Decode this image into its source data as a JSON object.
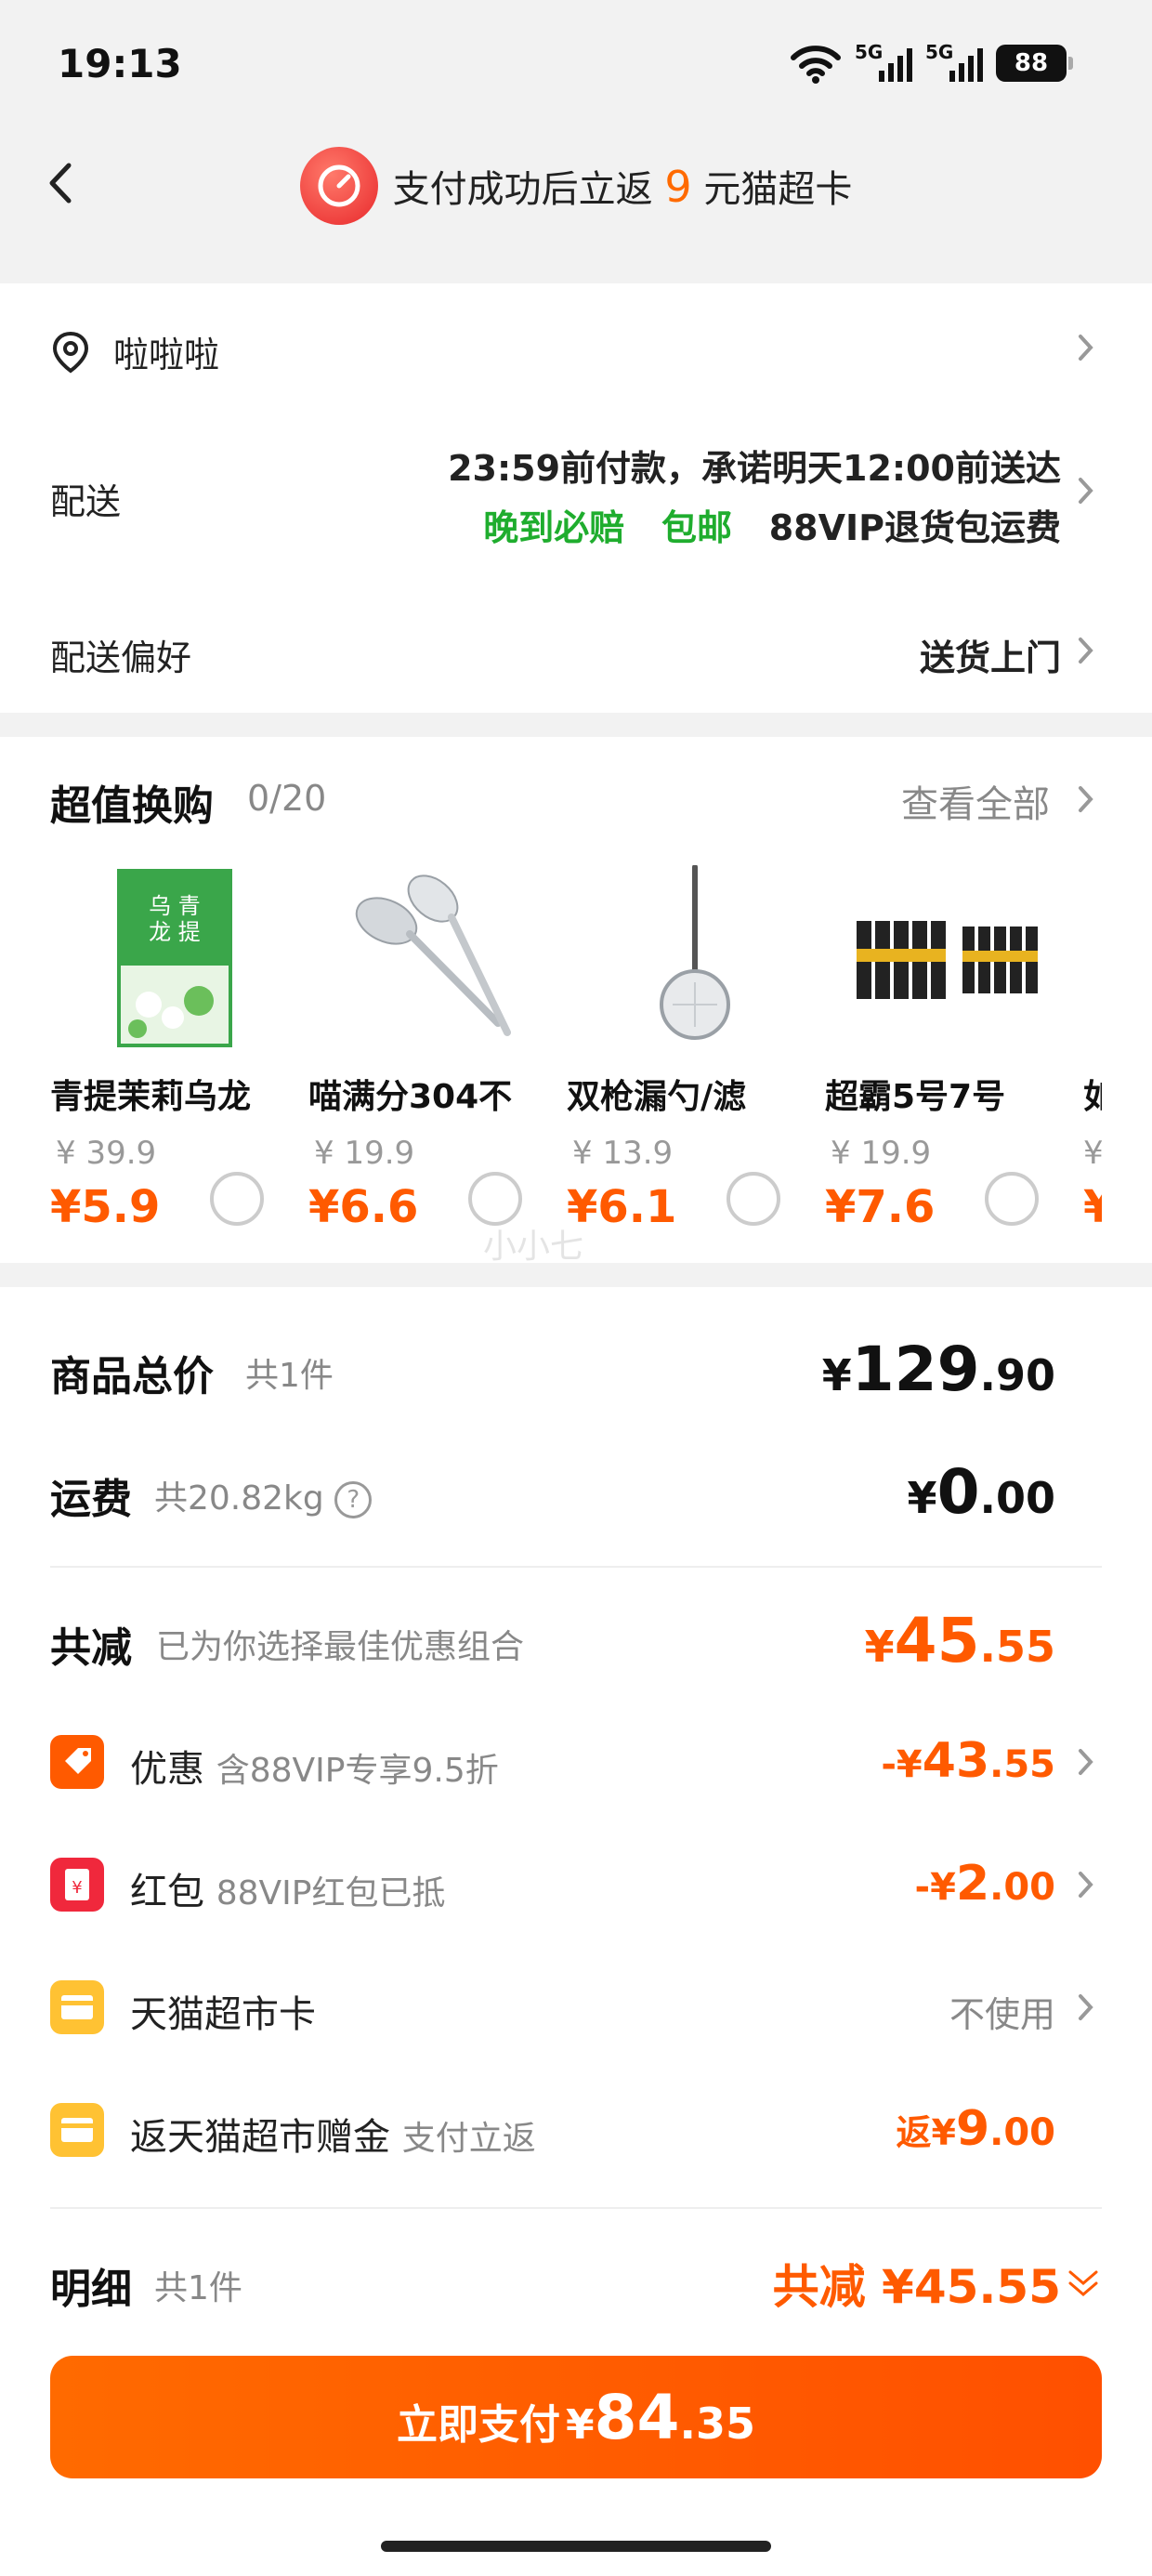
{
  "status": {
    "time": "19:13",
    "net1": "5G",
    "net2": "5G",
    "battery": "88"
  },
  "header": {
    "promo_pre": "支付成功后立返",
    "promo_num": "9",
    "promo_post": "元猫超卡"
  },
  "address": {
    "name": "啦啦啦"
  },
  "delivery": {
    "label": "配送",
    "line1": "23:59前付款，承诺明天12:00前送达",
    "tag_late": "晚到必赔",
    "tag_free": "包邮",
    "tag_vip": "88VIP退货包运费"
  },
  "preference": {
    "label": "配送偏好",
    "value": "送货上门"
  },
  "upsell": {
    "title": "超值换购",
    "count": "0/20",
    "view_all": "查看全部",
    "items": [
      {
        "name": "青提茉莉乌龙",
        "orig": "¥ 39.9",
        "price": "¥5.9",
        "img": "tea-box"
      },
      {
        "name": "喵满分304不",
        "orig": "¥ 19.9",
        "price": "¥6.6",
        "img": "spoons"
      },
      {
        "name": "双枪漏勺/滤",
        "orig": "¥ 13.9",
        "price": "¥6.1",
        "img": "strainer"
      },
      {
        "name": "超霸5号7号",
        "orig": "¥ 19.9",
        "price": "¥7.6",
        "img": "batteries"
      },
      {
        "name": "如",
        "orig": "¥",
        "price": "¥",
        "img": "partial"
      }
    ]
  },
  "watermark": "小小七",
  "summary": {
    "total_label": "商品总价",
    "total_sub": "共1件",
    "total_yen": "¥",
    "total_int": "129",
    "total_dec": ".90",
    "ship_label": "运费",
    "ship_sub": "共20.82kg",
    "ship_yen": "¥",
    "ship_int": "0",
    "ship_dec": ".00",
    "reduce_label": "共减",
    "reduce_sub": "已为你选择最佳优惠组合",
    "reduce_yen": "¥",
    "reduce_int": "45",
    "reduce_dec": ".55",
    "lines": [
      {
        "label": "优惠",
        "sub": "含88VIP专享9.5折",
        "prefix": "-¥",
        "int": "43",
        "dec": ".55",
        "icon": "coupon-icon",
        "color": "#ff5a00"
      },
      {
        "label": "红包",
        "sub": "88VIP红包已抵",
        "prefix": "-¥",
        "int": "2",
        "dec": ".00",
        "icon": "red-packet-icon",
        "color": "#f0283c"
      },
      {
        "label": "天猫超市卡",
        "sub": "",
        "value": "不使用",
        "icon": "card-icon",
        "color": "#ffc233"
      },
      {
        "label": "返天猫超市赠金",
        "sub": "支付立返",
        "prefix": "返¥",
        "int": "9",
        "dec": ".00",
        "icon": "gift-card-icon",
        "color": "#ffc233"
      }
    ],
    "detail_label": "明细",
    "detail_sub": "共1件",
    "detail_value": "共减 ¥45.55"
  },
  "pay": {
    "label": "立即支付",
    "yen": "¥",
    "int": "84",
    "dec": ".35"
  },
  "colors": {
    "accent": "#ff5a00",
    "green": "#1fad2e"
  }
}
